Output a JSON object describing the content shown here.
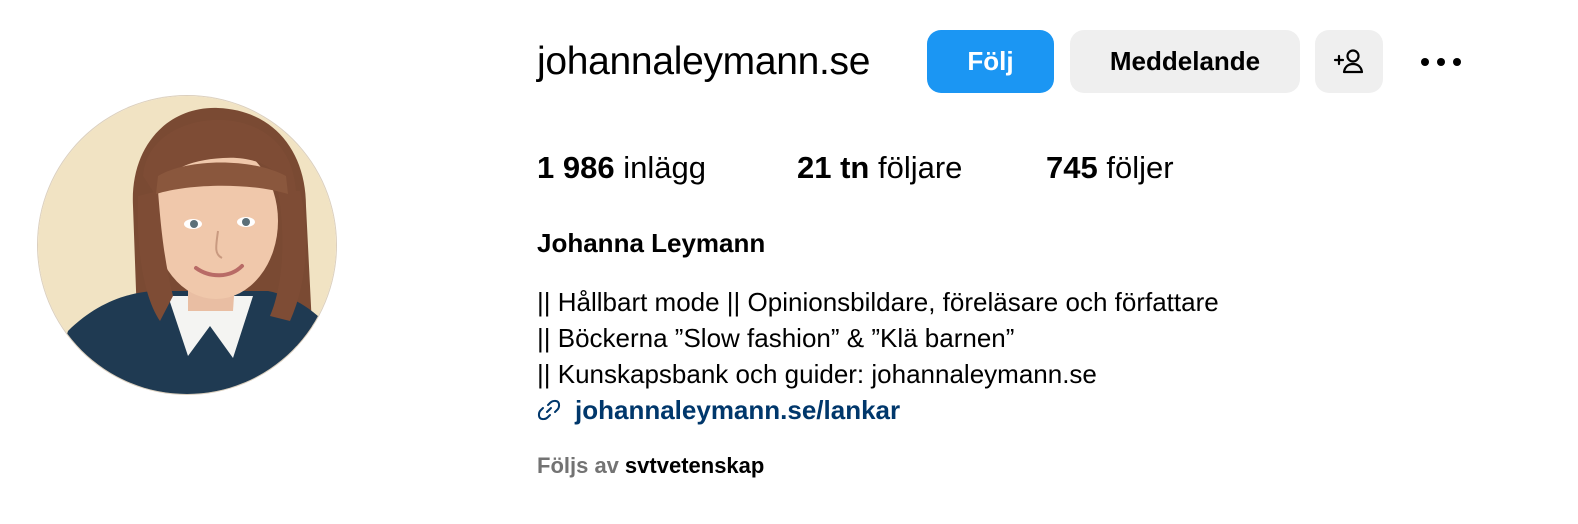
{
  "profile": {
    "username": "johannaleymann.se",
    "full_name": "Johanna Leymann",
    "avatar_icon": "profile-photo"
  },
  "actions": {
    "follow_label": "Följ",
    "message_label": "Meddelande",
    "suggest_icon": "add-person-icon",
    "more_icon": "more-dots-icon"
  },
  "stats": {
    "posts": {
      "count": "1 986",
      "label": "inlägg"
    },
    "followers": {
      "count": "21 tn",
      "label": "följare"
    },
    "following": {
      "count": "745",
      "label": "följer"
    }
  },
  "bio": {
    "lines": [
      "|| Hållbart mode || Opinionsbildare, föreläsare och författare",
      "|| Böckerna ”Slow fashion” & ”Klä barnen”",
      "|| Kunskapsbank och guider: johannaleymann.se"
    ],
    "link": "johannaleymann.se/lankar",
    "link_icon": "link-icon"
  },
  "followed_by": {
    "prefix": "Följs av",
    "name": "svtvetenskap"
  },
  "colors": {
    "follow_button": "#1b96f3",
    "secondary_button": "#efefef",
    "link": "#00376b",
    "muted_text": "#737373"
  }
}
